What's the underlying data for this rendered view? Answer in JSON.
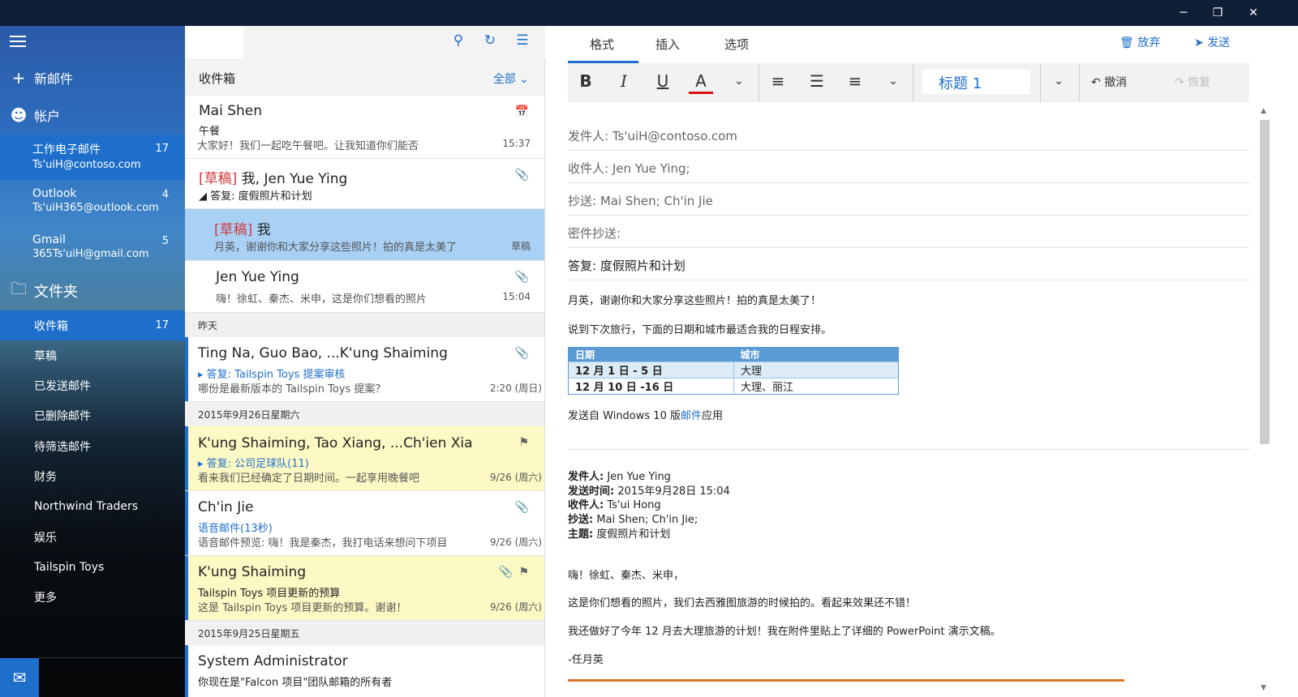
{
  "window": {
    "min": "─",
    "restore": "❐",
    "close": "✕"
  },
  "nav": {
    "new_mail": "新邮件",
    "accounts": "帐户",
    "folders_label": "文件夹",
    "account_list": [
      {
        "name": "工作电子邮件",
        "email": "Ts'uiH@contoso.com",
        "count": "17"
      },
      {
        "name": "Outlook",
        "email": "Ts'uiH365@outlook.com",
        "count": "4"
      },
      {
        "name": "Gmail",
        "email": "365Ts'uiH@gmail.com",
        "count": "5"
      }
    ],
    "folder_list": [
      {
        "name": "收件箱",
        "count": "17"
      },
      {
        "name": "草稿",
        "count": ""
      },
      {
        "name": "已发送邮件",
        "count": ""
      },
      {
        "name": "已删除邮件",
        "count": ""
      },
      {
        "name": "待筛选邮件",
        "count": ""
      },
      {
        "name": "财务",
        "count": ""
      },
      {
        "name": "Northwind Traders",
        "count": ""
      },
      {
        "name": "娱乐",
        "count": ""
      },
      {
        "name": "Tailspin Toys",
        "count": ""
      },
      {
        "name": "更多",
        "count": ""
      }
    ]
  },
  "list": {
    "title": "收件箱",
    "filter": "全部",
    "section_yesterday": "昨天",
    "section_0926": "2015年9月26日星期六",
    "section_0925": "2015年9月25日星期五",
    "messages": [
      {
        "from": "Mai Shen",
        "subject": "午餐",
        "preview": "大家好！我们一起吃午餐吧。让我知道你们能否",
        "time": "15:37"
      },
      {
        "draft": "[草稿]",
        "from": "我, Jen Yue Ying",
        "subject": "答复: 度假照片和计划"
      },
      {
        "draft": "[草稿]",
        "from": "我",
        "preview": "月英，谢谢你和大家分享这些照片！拍的真是太美了",
        "time": "草稿"
      },
      {
        "from": "Jen Yue Ying",
        "preview": "嗨！徐虹、秦杰、米申，这是你们想看的照片",
        "time": "15:04"
      },
      {
        "from": "Ting Na, Guo Bao, ...K'ung Shaiming",
        "subject": "答复: Tailspin Toys 提案审核",
        "preview": "哪份是最新版本的 Tailspin Toys 提案？",
        "time": "2:20 (周日)"
      },
      {
        "from": "K'ung Shaiming, Tao Xiang, ...Ch'ien Xia",
        "subject": "答复: 公司足球队(11)",
        "preview": "看来我们已经确定了日期时间。一起享用晚餐吧",
        "time": "9/26 (周六)"
      },
      {
        "from": "Ch'in Jie",
        "subject": "语音邮件(13秒)",
        "preview": "语音邮件预览: 嗨！我是秦杰，我打电话来想问下项目",
        "time": "9/26 (周六)"
      },
      {
        "from": "K'ung Shaiming",
        "subject": "Tailspin Toys 项目更新的预算",
        "preview": "这是 Tailspin Toys 项目更新的预算。谢谢！",
        "time": "9/26 (周六)"
      },
      {
        "from": "System Administrator",
        "subject": "你现在是\"Falcon 项目\"团队邮箱的所有者"
      }
    ]
  },
  "compose": {
    "tabs": [
      "格式",
      "插入",
      "选项"
    ],
    "discard": "放弃",
    "send": "发送",
    "style": "标题 1",
    "undo": "撤消",
    "redo": "恢复",
    "from": "发件人: Ts'uiH@contoso.com",
    "to": "收件人: Jen Yue Ying;",
    "cc": "抄送: Mai Shen; Ch'in Jie",
    "bcc": "密件抄送:",
    "subject": "答复: 度假照片和计划",
    "body1": "月英，谢谢你和大家分享这些照片！拍的真是太美了！",
    "body2": "说到下次旅行，下面的日期和城市最适合我的日程安排。",
    "table": {
      "headers": [
        "日期",
        "城市"
      ],
      "rows": [
        [
          "12 月 1 日 - 5 日",
          "大理"
        ],
        [
          "12 月 10 日 -16 日",
          "大理、丽江"
        ]
      ]
    },
    "sig_pre": "发送自 Windows 10 版",
    "sig_link": "邮件",
    "sig_post": "应用",
    "quoted": {
      "from_lbl": "发件人:",
      "from": " Jen Yue Ying",
      "sent_lbl": "发送时间:",
      "sent": " 2015年9月28日 15:04",
      "to_lbl": "收件人:",
      "to": " Ts'ui Hong",
      "cc_lbl": "抄送:",
      "cc": " Mai Shen; Ch'in Jie;",
      "subj_lbl": "主题:",
      "subj": " 度假照片和计划",
      "line1": "嗨！徐虹、秦杰、米申，",
      "line2": "这是你们想看的照片，我们去西雅图旅游的时候拍的。看起来效果还不错！",
      "line3": "我还做好了今年 12 月去大理旅游的计划！我在附件里贴上了详细的 PowerPoint 演示文稿。",
      "line4": "-任月英"
    }
  }
}
